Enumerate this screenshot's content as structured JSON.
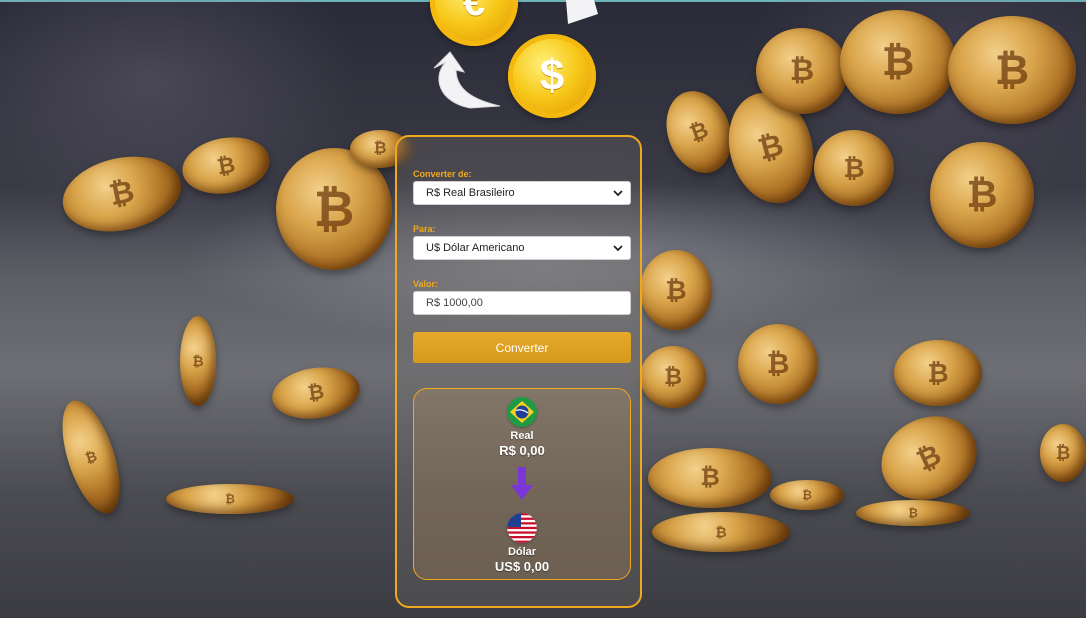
{
  "converter": {
    "from_label": "Converter de:",
    "from_selected": "R$ Real Brasileiro",
    "to_label": "Para:",
    "to_selected": "U$ Dólar Americano",
    "value_label": "Valor:",
    "value_placeholder": "R$ 1000,00",
    "convert_button": "Converter"
  },
  "result": {
    "from_currency_name": "Real",
    "from_currency_value": "R$ 0,00",
    "to_currency_name": "Dólar",
    "to_currency_value": "US$ 0,00"
  },
  "icons": {
    "euro_coin": "euro-coin-icon",
    "dollar_coin": "dollar-coin-icon",
    "cycle_arrow": "cycle-arrow-icon",
    "chevron": "chevron-down-icon",
    "brazil_flag": "brazil-flag-icon",
    "usa_flag": "usa-flag-icon",
    "down_arrow": "down-arrow-icon"
  },
  "colors": {
    "accent": "#f0a81e",
    "button": "#dea024",
    "arrow": "#7a36d8"
  }
}
